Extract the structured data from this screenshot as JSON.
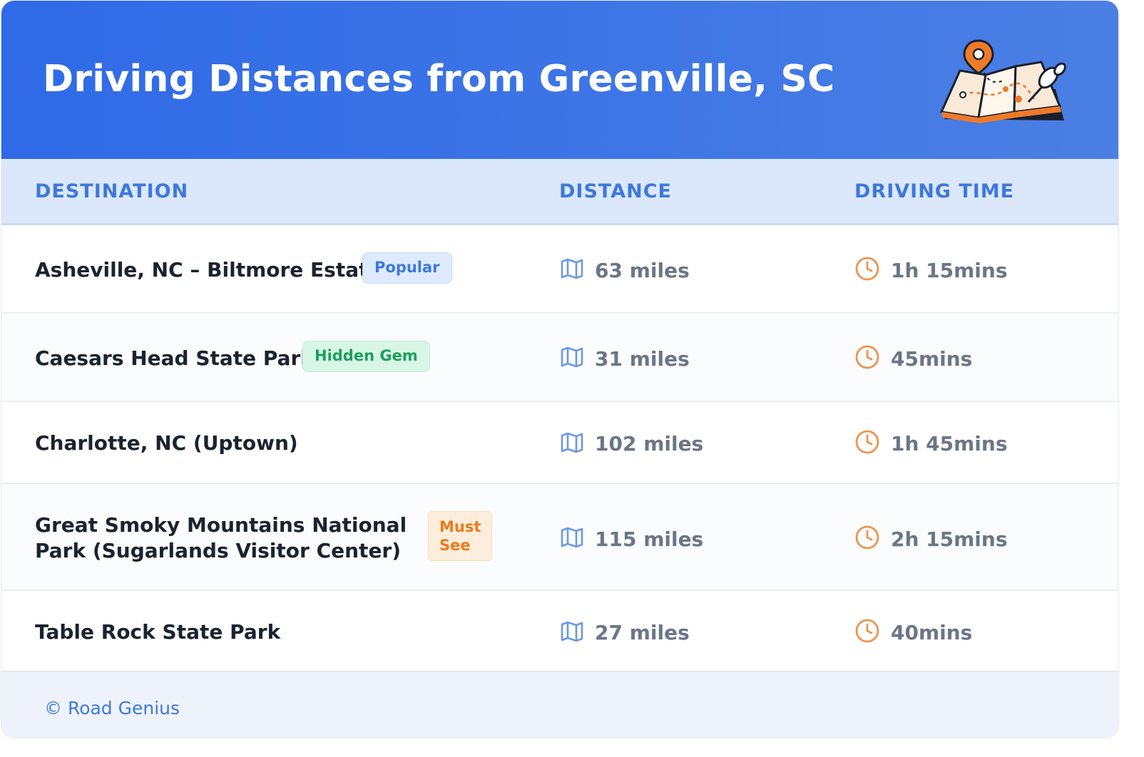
{
  "header": {
    "title": "Driving Distances from Greenville, SC",
    "illustration": "map-with-pins-icon"
  },
  "table": {
    "columns": [
      "DESTINATION",
      "DISTANCE",
      "DRIVING TIME"
    ],
    "rows": [
      {
        "destination": "Asheville, NC – Biltmore Estate",
        "badge": "Popular",
        "badge_color": "#3f78dc",
        "distance": "63 miles",
        "time": "1h 15mins"
      },
      {
        "destination": "Caesars Head State Park",
        "badge": "Hidden Gem",
        "badge_color": "#1f9e5e",
        "distance": "31 miles",
        "time": "45mins"
      },
      {
        "destination": "Charlotte, NC (Uptown)",
        "badge": "",
        "distance": "102 miles",
        "time": "1h 45mins"
      },
      {
        "destination_line1": "Great Smoky Mountains National",
        "destination_line2": "Park (Sugarlands Visitor Center)",
        "badge_line1": "Must",
        "badge_line2": "See",
        "badge_color": "#ec7a1c",
        "distance": "115 miles",
        "time": "2h 15mins"
      },
      {
        "destination": "Table Rock State Park",
        "badge": "",
        "distance": "27 miles",
        "time": "40mins"
      }
    ],
    "icons": {
      "distance": "map-icon",
      "time": "clock-icon"
    }
  },
  "footer": {
    "credit": "© Road Genius"
  },
  "colors": {
    "header_gradient_start": "#2f6ae7",
    "header_gradient_end": "#4a7fe4",
    "accent_blue": "#3f78dc",
    "accent_orange": "#ec7a1c"
  }
}
